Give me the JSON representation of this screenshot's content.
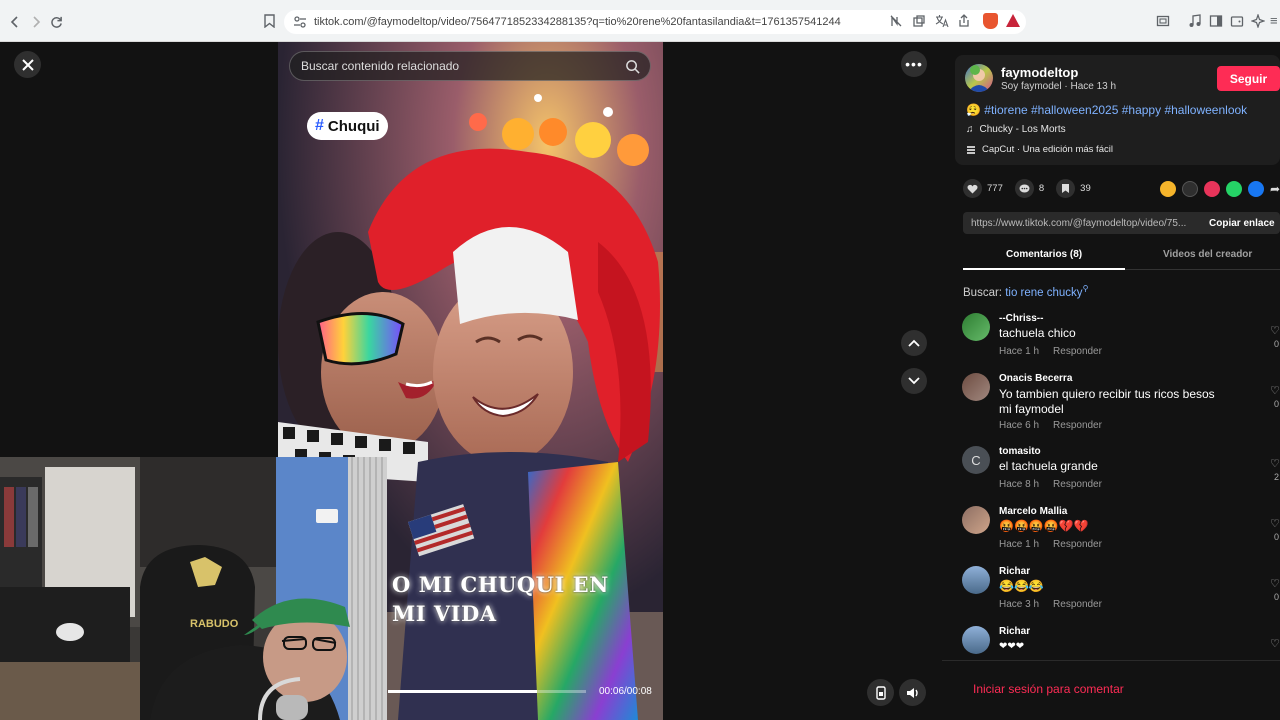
{
  "browser": {
    "url": "tiktok.com/@faymodeltop/video/7564771852334288135?q=tio%20rene%20fantasilandia&t=1761357541244"
  },
  "video": {
    "search_placeholder": "Buscar contenido relacionado",
    "hashtag_pill": "Chuqui",
    "caption_line1": "O MI CHUQUI EN",
    "caption_line2": "MI VIDA",
    "progress_fraction": 0.75,
    "timecode": "00:06/00:08"
  },
  "author": {
    "name": "faymodeltop",
    "subtitle": "Soy faymodel · Hace 13 h",
    "follow_label": "Seguir"
  },
  "description": {
    "emoji": "😮‍💨",
    "hashtags": "#tiorene #halloween2025 #happy #halloweenlook",
    "music": "Chucky - Los Morts",
    "capcut": "CapCut · Una edición más fácil"
  },
  "stats": {
    "likes": "777",
    "comments": "8",
    "saves": "39"
  },
  "link": {
    "url": "https://www.tiktok.com/@faymodeltop/video/75...",
    "copy_label": "Copiar enlace"
  },
  "tabs": {
    "comments": "Comentarios (8)",
    "creator_videos": "Videos del creador"
  },
  "search_related": {
    "label": "Buscar:",
    "term": "tio rene chucky"
  },
  "comments": [
    {
      "name": "--Chriss--",
      "text": "tachuela chico",
      "time": "Hace 1 h",
      "reply": "Responder",
      "likes": "0"
    },
    {
      "name": "Onacis Becerra",
      "text": "Yo tambien quiero recibir tus ricos besos mi faymodel",
      "time": "Hace 6 h",
      "reply": "Responder",
      "likes": "0"
    },
    {
      "name": "tomasito",
      "text": "el tachuela grande",
      "time": "Hace 8 h",
      "reply": "Responder",
      "likes": "2"
    },
    {
      "name": "Marcelo Mallia",
      "text": "🤬🤬🤬🤬💔💔",
      "time": "Hace 1 h",
      "reply": "Responder",
      "likes": "0"
    },
    {
      "name": "Richar",
      "text": "😂😂😂",
      "time": "Hace 3 h",
      "reply": "Responder",
      "likes": "0"
    },
    {
      "name": "Richar",
      "text": "❤❤❤",
      "time": "",
      "reply": "",
      "likes": ""
    }
  ],
  "login": {
    "label": "Iniciar sesión para comentar"
  },
  "webcam": {
    "chair_brand": "RABUDO"
  },
  "colors": {
    "accent": "#fe2c55",
    "link_blue": "#7fb2ff",
    "panel_bg": "#121212"
  }
}
